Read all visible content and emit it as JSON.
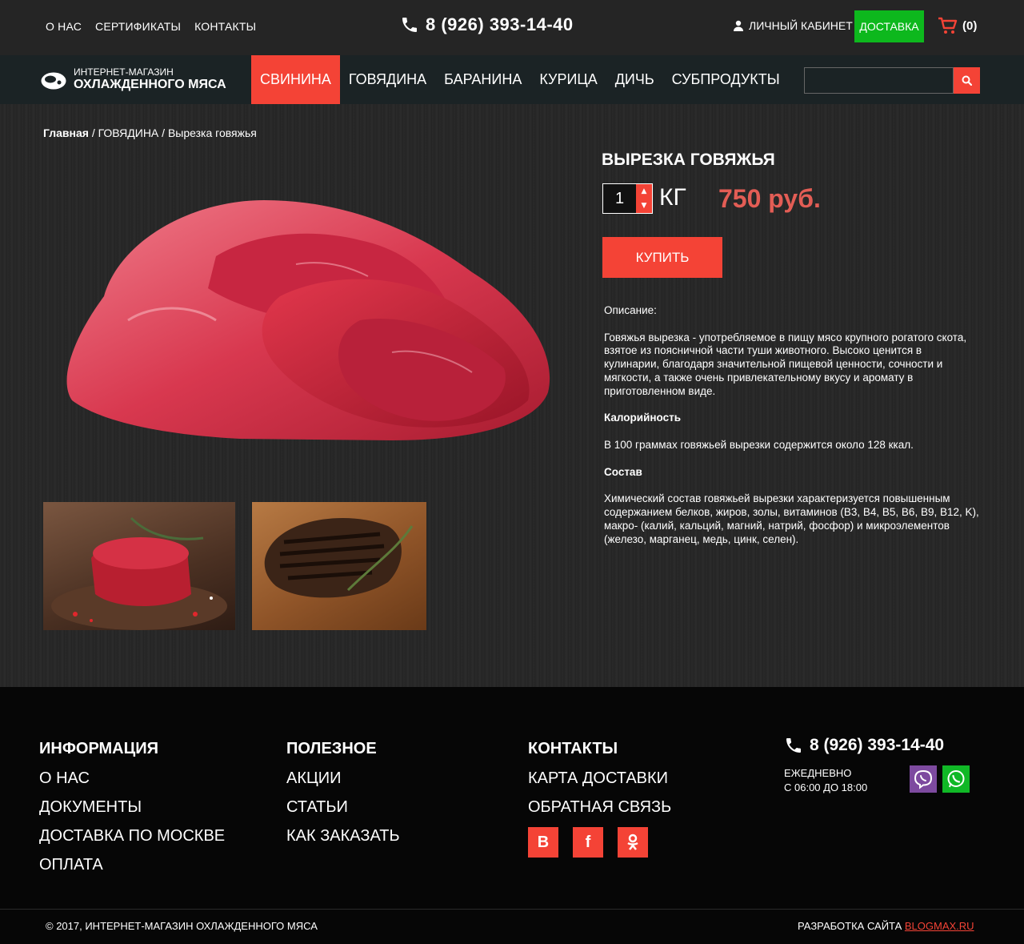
{
  "topbar": {
    "links": [
      "О НАС",
      "СЕРТИФИКАТЫ",
      "КОНТАКТЫ"
    ],
    "phone": "8 (926) 393-14-40",
    "account_label": "ЛИЧНЫЙ КАБИНЕТ",
    "delivery_label": "ДОСТАВКА",
    "cart_count": "(0)"
  },
  "logo": {
    "line1": "ИНТЕРНЕТ-МАГАЗИН",
    "line2": "ОХЛАЖДЕННОГО МЯСА"
  },
  "menu": {
    "items": [
      "СВИНИНА",
      "ГОВЯДИНА",
      "БАРАНИНА",
      "КУРИЦА",
      "ДИЧЬ",
      "СУБПРОДУКТЫ"
    ],
    "active_index": 0
  },
  "search": {
    "placeholder": ""
  },
  "breadcrumb": {
    "home": "Главная",
    "category": "ГОВЯДИНА",
    "current": "Вырезка говяжья"
  },
  "product": {
    "title": "ВЫРЕЗКА ГОВЯЖЬЯ",
    "quantity": "1",
    "unit": "КГ",
    "price": "750 руб.",
    "buy_label": "КУПИТЬ",
    "desc_heading": "Описание:",
    "desc_text": "Говяжья вырезка - употребляемое в пищу мясо крупного рогатого скота, взятое из поясничной части туши животного. Высоко ценится в кулинарии, благодаря значительной пищевой ценности, сочности и мягкости, а также очень привлекательному вкусу и аромату в приготовленном виде.",
    "calories_heading": "Калорийность",
    "calories_text": "В 100 граммах говяжьей вырезки содержится около 128 ккал.",
    "composition_heading": "Состав",
    "composition_text": "Химический состав говяжьей вырезки характеризуется повышенным содержанием белков, жиров, золы, витаминов (B3, B4, B5, B6, B9, B12, K), макро- (калий, кальций, магний, натрий, фосфор) и микроэлементов (железо, марганец, медь, цинк, селен)."
  },
  "footer": {
    "info_heading": "ИНФОРМАЦИЯ",
    "info_links": [
      "О НАС",
      "ДОКУМЕНТЫ",
      "ДОСТАВКА ПО МОСКВЕ",
      "ОПЛАТА"
    ],
    "useful_heading": "ПОЛЕЗНОЕ",
    "useful_links": [
      "АКЦИИ",
      "СТАТЬИ",
      "КАК ЗАКАЗАТЬ"
    ],
    "contacts_heading": "КОНТАКТЫ",
    "contacts_links": [
      "КАРТА ДОСТАВКИ",
      "ОБРАТНАЯ СВЯЗЬ"
    ],
    "social": [
      "В",
      "f",
      "ok-icon"
    ],
    "phone": "8 (926) 393-14-40",
    "hours_line1": "ЕЖЕДНЕВНО",
    "hours_line2": "С 06:00 ДО 18:00",
    "copyright": "© 2017, ИНТЕРНЕТ-МАГАЗИН ОХЛАЖДЕННОГО МЯСА",
    "dev_label": "РАЗРАБОТКА САЙТА",
    "dev_link": "BLOGMAX.RU"
  },
  "colors": {
    "accent": "#f44336",
    "delivery_green": "#0db81d",
    "price": "#e35d55",
    "viber": "#7d4a9f",
    "whatsapp": "#10b826"
  }
}
